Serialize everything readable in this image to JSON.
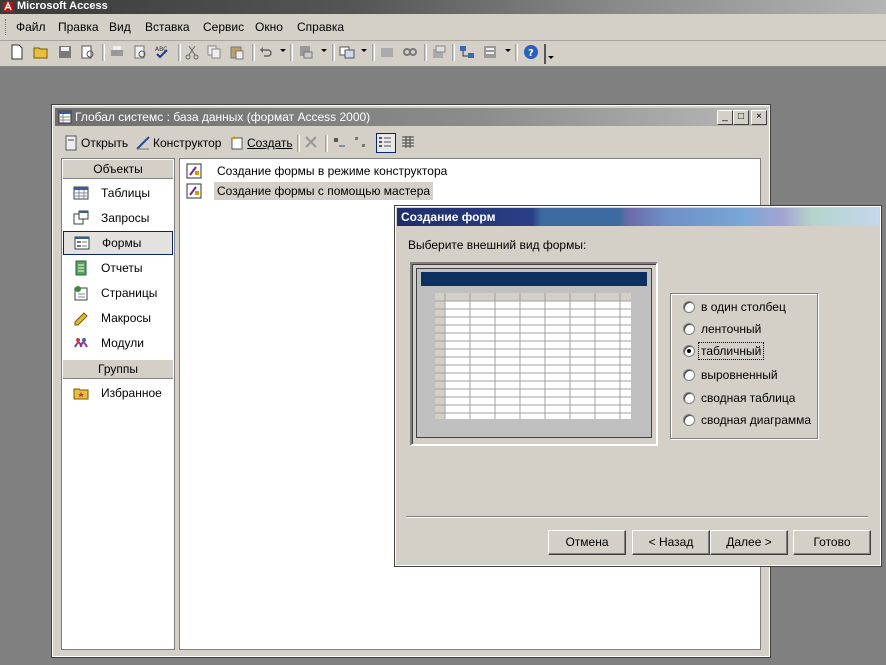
{
  "app": {
    "title": "Microsoft Access"
  },
  "menu": [
    "Файл",
    "Правка",
    "Вид",
    "Вставка",
    "Сервис",
    "Окно",
    "Справка"
  ],
  "db_window": {
    "title": "Глобал системс : база данных (формат Access 2000)",
    "toolbar": {
      "open": "Открыть",
      "design": "Конструктор",
      "create": "Создать"
    },
    "objects_header": "Объекты",
    "objects": [
      "Таблицы",
      "Запросы",
      "Формы",
      "Отчеты",
      "Страницы",
      "Макросы",
      "Модули"
    ],
    "selected_object": "Формы",
    "groups_header": "Группы",
    "groups": [
      "Избранное"
    ],
    "list_items": [
      "Создание формы в режиме конструктора",
      "Создание формы с помощью мастера"
    ]
  },
  "wizard": {
    "title": "Создание форм",
    "prompt": "Выберите внешний вид формы:",
    "options": [
      "в один столбец",
      "ленточный",
      "табличный",
      "выровненный",
      "сводная таблица",
      "сводная диаграмма"
    ],
    "selected_option": "табличный",
    "buttons": {
      "cancel": "Отмена",
      "back": "< Назад",
      "next": "Далее >",
      "finish": "Готово"
    }
  },
  "colors": {
    "selection_border": "#0a246a",
    "preview_header": "#0c3060",
    "face": "#d4d0c8"
  }
}
